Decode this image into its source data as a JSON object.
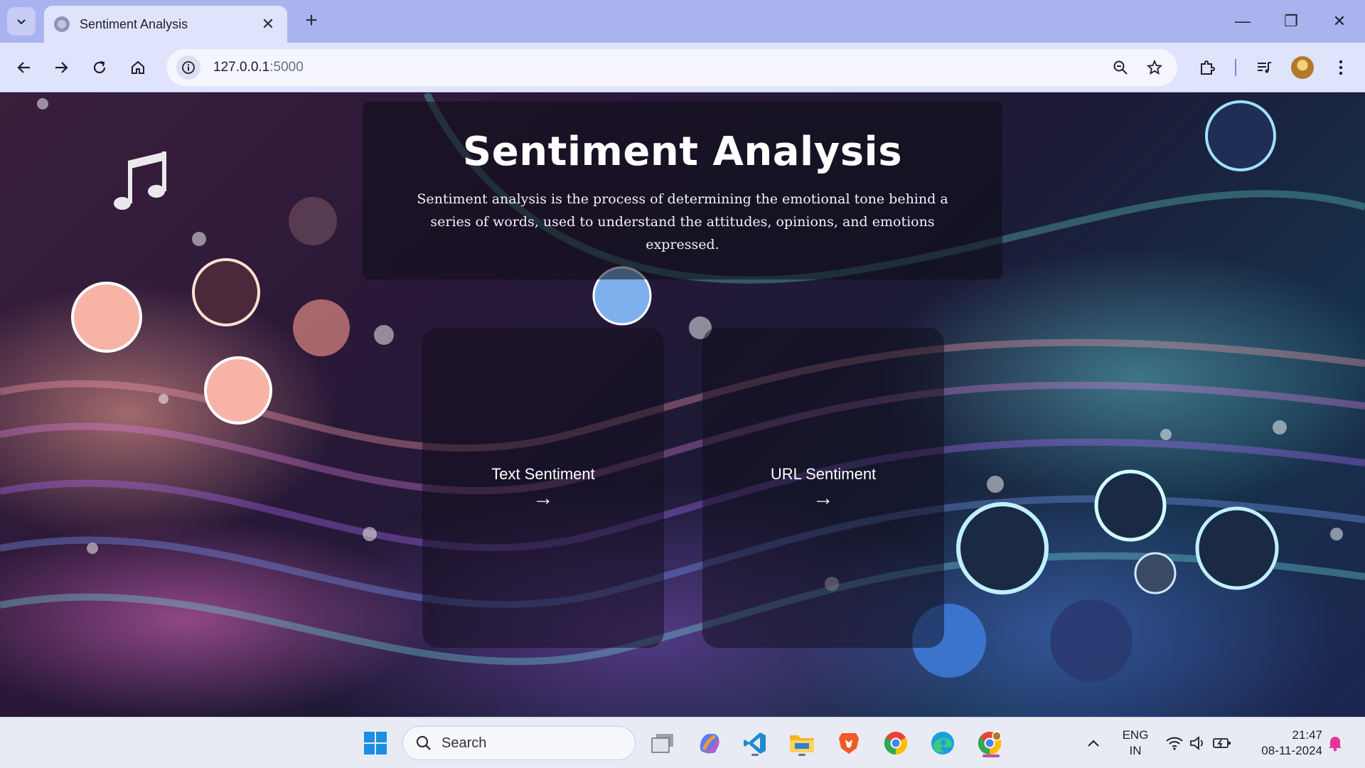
{
  "browser": {
    "tab_title": "Sentiment Analysis",
    "tab_close": "✕",
    "new_tab": "+",
    "url_host": "127.0.0.1",
    "url_port": ":5000",
    "window_controls": {
      "minimize": "—",
      "restore": "❐",
      "close": "✕"
    }
  },
  "page": {
    "title": "Sentiment Analysis",
    "description": "Sentiment analysis is the process of determining the emotional tone behind a series of words, used to understand the attitudes, opinions, and emotions expressed.",
    "cards": [
      {
        "label": "Text Sentiment",
        "arrow": "→"
      },
      {
        "label": "URL Sentiment",
        "arrow": "→"
      }
    ]
  },
  "taskbar": {
    "search_label": "Search",
    "language": "ENG",
    "region": "IN",
    "time": "21:47",
    "date": "08-11-2024",
    "tray_up_arrow": "^"
  },
  "colors": {
    "tabstrip": "#a9b3ee",
    "toolbar": "#dfe3fb",
    "hero_panel": "rgba(12,12,22,0.55)",
    "taskbar": "#e8ebf4"
  }
}
